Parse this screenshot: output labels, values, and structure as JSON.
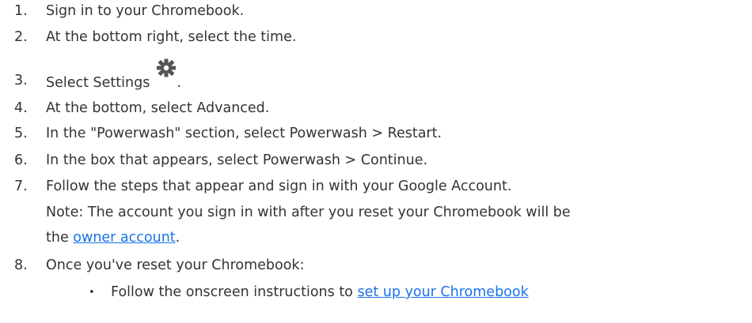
{
  "steps": [
    {
      "num": "1.",
      "text": "Sign in to your Chromebook."
    },
    {
      "num": "2.",
      "text": "At the bottom right, select the time."
    },
    {
      "num": "3.",
      "text": "Select Settings",
      "icon": "gear-icon",
      "after_icon": "."
    },
    {
      "num": "4.",
      "text": "At the bottom, select Advanced."
    },
    {
      "num": "5.",
      "text": "In the \"Powerwash\" section, select Powerwash > Restart."
    },
    {
      "num": "6.",
      "text": "In the box that appears, select Powerwash > Continue."
    },
    {
      "num": "7.",
      "text": "Follow the steps that appear and sign in with your Google Account.",
      "note": "Note: The account you sign in with after you reset your Chromebook will be",
      "note_prefix": "the ",
      "note_link": "owner account",
      "note_suffix": "."
    },
    {
      "num": "8.",
      "text": "Once you've reset your Chromebook:",
      "sub_items": [
        {
          "bullet": "•",
          "text": "Follow the onscreen instructions to ",
          "link": "set up your Chromebook"
        }
      ]
    }
  ],
  "colors": {
    "text": "#333333",
    "link": "#1a73e8",
    "icon": "#555555"
  }
}
